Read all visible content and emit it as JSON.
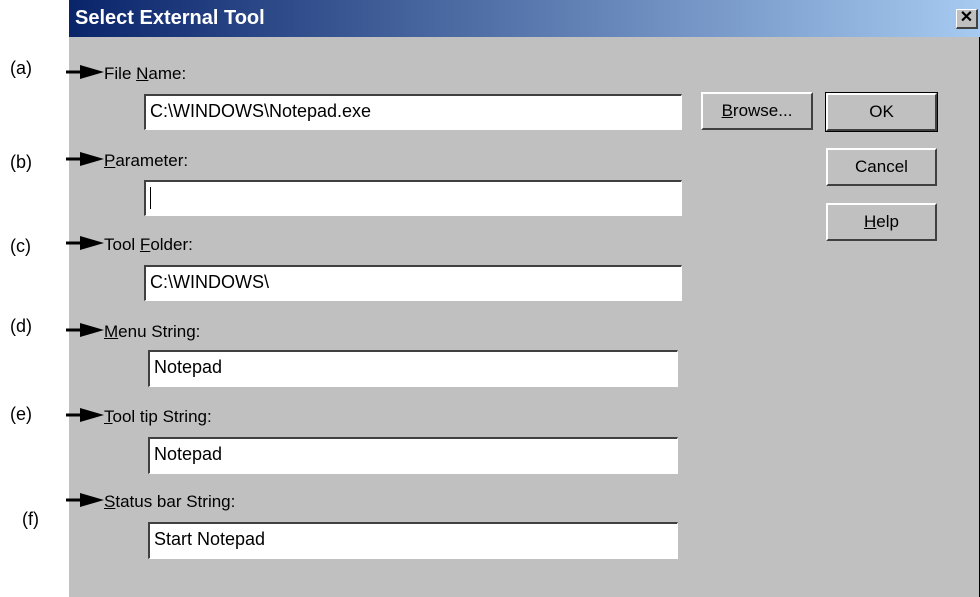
{
  "dialog": {
    "title": "Select External Tool",
    "close_glyph": "✕"
  },
  "callouts": [
    "(a)",
    "(b)",
    "(c)",
    "(d)",
    "(e)",
    "(f)"
  ],
  "fields": [
    {
      "label_prefix": "File ",
      "label_accel": "N",
      "label_suffix": "ame:",
      "value": "C:\\WINDOWS\\Notepad.exe"
    },
    {
      "label_prefix": "",
      "label_accel": "P",
      "label_suffix": "arameter:",
      "value": ""
    },
    {
      "label_prefix": "Tool ",
      "label_accel": "F",
      "label_suffix": "older:",
      "value": "C:\\WINDOWS\\"
    },
    {
      "label_prefix": "",
      "label_accel": "M",
      "label_suffix": "enu String:",
      "value": "Notepad"
    },
    {
      "label_prefix": "",
      "label_accel": "T",
      "label_suffix": "ool tip String:",
      "value": "Notepad"
    },
    {
      "label_prefix": "",
      "label_accel": "S",
      "label_suffix": "tatus bar String:",
      "value": "Start Notepad"
    }
  ],
  "buttons": {
    "browse": {
      "accel": "B",
      "rest": "rowse..."
    },
    "ok": "OK",
    "cancel": "Cancel",
    "help": {
      "accel": "H",
      "rest": "elp"
    }
  },
  "colors": {
    "title_start": "#0a246a",
    "title_end": "#a6caf0",
    "face": "#c0c0c0"
  }
}
